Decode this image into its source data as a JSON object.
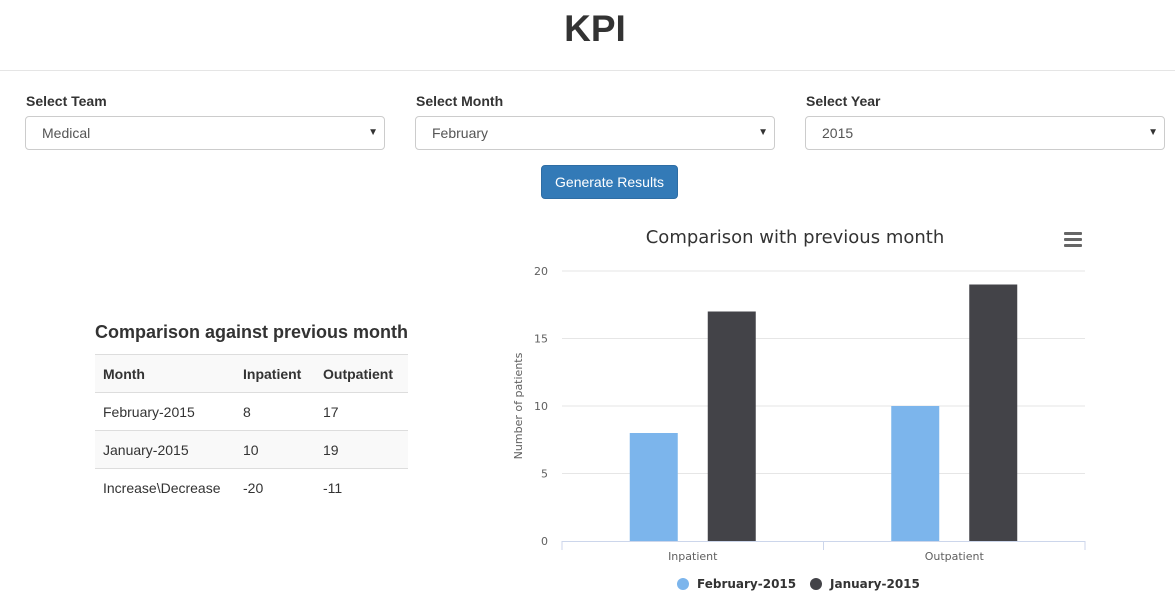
{
  "header": {
    "title": "KPI"
  },
  "filters": {
    "team": {
      "label": "Select Team",
      "value": "Medical"
    },
    "month": {
      "label": "Select Month",
      "value": "February"
    },
    "year": {
      "label": "Select Year",
      "value": "2015"
    }
  },
  "actions": {
    "generate_label": "Generate Results"
  },
  "comparison_table": {
    "title": "Comparison against previous month",
    "headers": [
      "Month",
      "Inpatient",
      "Outpatient"
    ],
    "rows": [
      [
        "February-2015",
        "8",
        "17"
      ],
      [
        "January-2015",
        "10",
        "19"
      ],
      [
        "Increase\\Decrease",
        "-20",
        "-11"
      ]
    ]
  },
  "icons": {
    "chart_menu": "hamburger-icon",
    "select_caret": "caret-down-icon"
  },
  "colors": {
    "primary_button": "#337ab7",
    "series_feb": "#7cb5ec",
    "series_jan": "#434348"
  },
  "chart_data": {
    "type": "bar",
    "title": "Comparison with previous month",
    "xlabel": "",
    "ylabel": "Number of patients",
    "categories": [
      "Inpatient",
      "Outpatient"
    ],
    "series": [
      {
        "name": "February-2015",
        "values": [
          8,
          10
        ],
        "color": "#7cb5ec"
      },
      {
        "name": "January-2015",
        "values": [
          17,
          19
        ],
        "color": "#434348"
      }
    ],
    "ylim": [
      0,
      20
    ],
    "yticks": [
      0,
      5,
      10,
      15,
      20
    ],
    "grid": true,
    "legend": "bottom-center"
  }
}
